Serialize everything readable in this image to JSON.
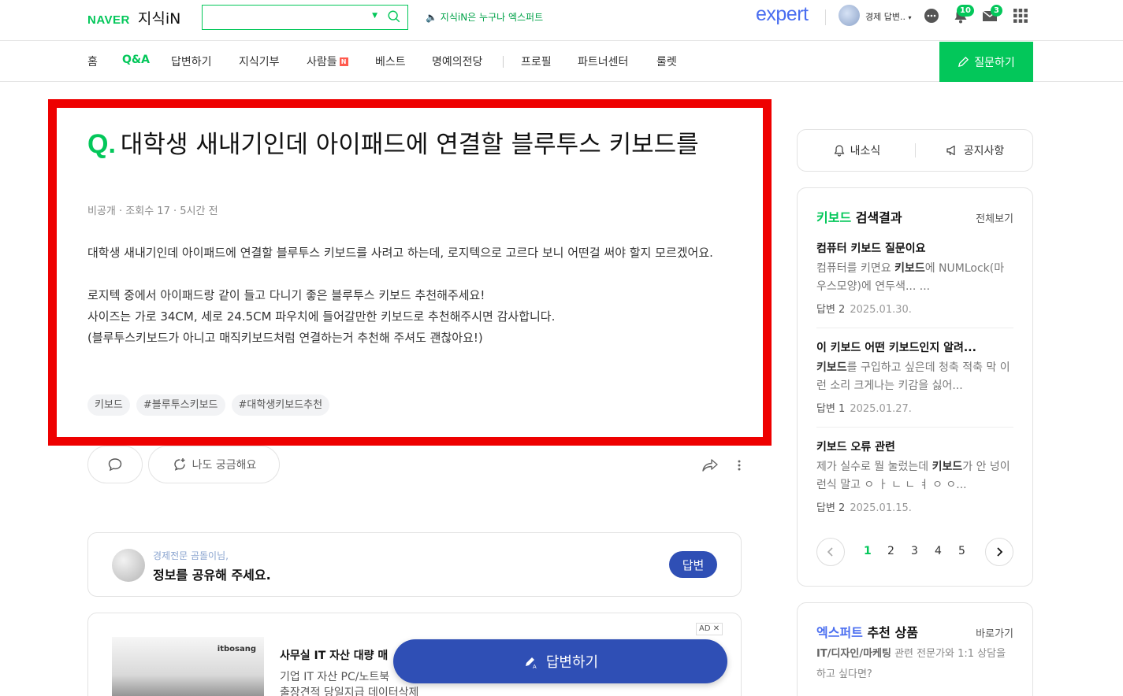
{
  "header": {
    "logo_naver": "NAVER",
    "logo_kin": "지식iN",
    "search_value": "",
    "notice": "지식iN은 누구나 엑스퍼트",
    "expert_logo": "expert",
    "user_name": "경제 답변..",
    "notif_count": "10",
    "mail_count": "3"
  },
  "nav": {
    "items": [
      "홈",
      "Q&A",
      "답변하기",
      "지식기부",
      "사람들",
      "베스트",
      "명예의전당",
      "프로필",
      "파트너센터",
      "룰렛"
    ],
    "new_badge": "N",
    "ask_button": "질문하기"
  },
  "question": {
    "q_mark": "Q.",
    "title": "대학생 새내기인데 아이패드에 연결할 블루투스 키보드를",
    "author": "비공개",
    "views": "조회수 17",
    "time": "5시간 전",
    "body": [
      "대학생 새내기인데 아이패드에 연결할 블루투스 키보드를 사려고 하는데, 로지텍으로 고르다 보니 어떤걸 써야 할지 모르겠어요.",
      "",
      "로지텍 중에서 아이패드랑 같이 들고 다니기 좋은 블루투스 키보드 추천해주세요!",
      "사이즈는 가로 34CM, 세로 24.5CM 파우치에 들어갈만한 키보드로 추천해주시면 감사합니다.",
      "(블루투스키보드가 아니고 매직키보드처럼 연결하는거 추천해 주셔도 괜찮아요!)"
    ],
    "tags": [
      "키보드",
      "#블루투스키보드",
      "#대학생키보드추천"
    ],
    "curious_label": "나도 궁금해요"
  },
  "answer_prompt": {
    "who": "경제전문 곰돌이님,",
    "message": "정보를 공유해 주세요.",
    "button": "답변"
  },
  "ad": {
    "badge": "AD",
    "brand": "itbosang",
    "title": "사무실 IT 자산 대량 매",
    "line1": "기업 IT 자산 PC/노트북",
    "line2": "출장견적 당일지급 데이터삭제"
  },
  "floating": {
    "answer_button": "답변하기"
  },
  "sidebar": {
    "news": "내소식",
    "notices": "공지사항",
    "search_keyword": "키보드",
    "search_suffix": " 검색결과",
    "see_all": "전체보기",
    "results": [
      {
        "title": "컴퓨터 키보드 질문이요",
        "snippet_pre": "컴퓨터를 키면요 ",
        "snippet_kw": "키보드",
        "snippet_post": "에 NUMLock(마우스모양)에 연두색... ...",
        "answers": "답변 2",
        "date": "2025.01.30."
      },
      {
        "title": "이 키보드 어떤 키보드인지 알려...",
        "snippet_pre": "",
        "snippet_kw": "키보드",
        "snippet_post": "를 구입하고 싶은데 청축 적축 막 이런 소리 크게나는 키감을 싫어...",
        "answers": "답변 1",
        "date": "2025.01.27."
      },
      {
        "title": "키보드 오류 관련",
        "snippet_pre": "제가 실수로 뭘 눌렀는데 ",
        "snippet_kw": "키보드",
        "snippet_post": "가 안 넝이런식 말고 ㅇ ㅏ ㄴ ㄴ ㅕ ㅇ ㅇ...",
        "answers": "답변 2",
        "date": "2025.01.15."
      }
    ],
    "pages": [
      "1",
      "2",
      "3",
      "4",
      "5"
    ],
    "expert_kw": "엑스퍼트",
    "expert_suffix": " 추천 상품",
    "expert_more": "바로가기",
    "expert_text_b": "IT/디자인/마케팅",
    "expert_text": " 관련 전문가와 1:1 상담을 하고 싶다면?"
  },
  "colors": {
    "brand_green": "#03c75a",
    "answer_blue": "#2f4fb5",
    "highlight_red": "#ee0000"
  }
}
